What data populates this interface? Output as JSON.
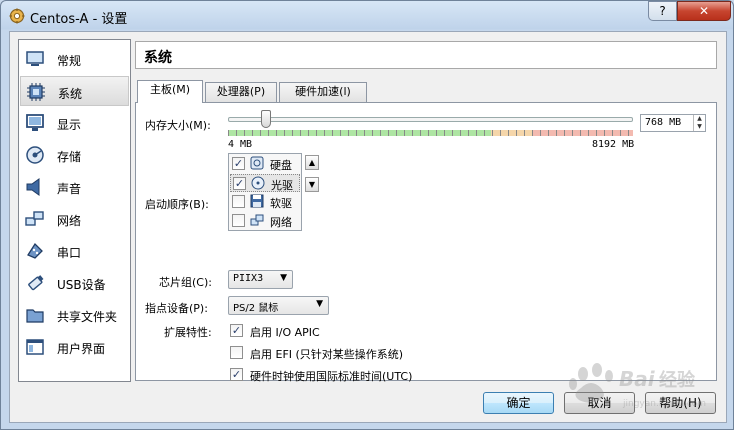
{
  "window": {
    "title": "Centos-A - 设置",
    "help_glyph": "?",
    "close_glyph": "✕"
  },
  "sidebar": {
    "items": [
      {
        "label": "常规",
        "icon": "general-icon"
      },
      {
        "label": "系统",
        "icon": "system-icon",
        "selected": true
      },
      {
        "label": "显示",
        "icon": "display-icon"
      },
      {
        "label": "存储",
        "icon": "storage-icon"
      },
      {
        "label": "声音",
        "icon": "audio-icon"
      },
      {
        "label": "网络",
        "icon": "network-icon"
      },
      {
        "label": "串口",
        "icon": "serial-port-icon"
      },
      {
        "label": "USB设备",
        "icon": "usb-icon"
      },
      {
        "label": "共享文件夹",
        "icon": "shared-folder-icon"
      },
      {
        "label": "用户界面",
        "icon": "user-interface-icon"
      }
    ]
  },
  "header": {
    "title": "系统"
  },
  "tabs": [
    {
      "label": "主板(M)",
      "active": true
    },
    {
      "label": "处理器(P)",
      "active": false
    },
    {
      "label": "硬件加速(l)",
      "active": false
    }
  ],
  "motherboard": {
    "memory": {
      "label": "内存大小(M):",
      "min_label": "4 MB",
      "max_label": "8192 MB",
      "min_mb": 4,
      "max_mb": 8192,
      "value_mb": 768,
      "value_text": "768 MB",
      "zones": {
        "green_fraction": 0.65,
        "orange_fraction": 0.1,
        "red_fraction": 0.25
      }
    },
    "boot_order": {
      "label": "启动顺序(B):",
      "items": [
        {
          "label": "硬盘",
          "checked": true,
          "icon": "hard-disk-icon"
        },
        {
          "label": "光驱",
          "checked": true,
          "icon": "optical-drive-icon",
          "selected": true
        },
        {
          "label": "软驱",
          "checked": false,
          "icon": "floppy-icon"
        },
        {
          "label": "网络",
          "checked": false,
          "icon": "network-boot-icon"
        }
      ],
      "move_up_glyph": "▲",
      "move_down_glyph": "▼"
    },
    "chipset": {
      "label": "芯片组(C):",
      "value": "PIIX3"
    },
    "pointing_device": {
      "label": "指点设备(P):",
      "value": "PS/2 鼠标"
    },
    "extended_features": {
      "label": "扩展特性:",
      "options": [
        {
          "label": "启用 I/O APIC",
          "checked": true
        },
        {
          "label": "启用 EFI (只针对某些操作系统)",
          "checked": false
        },
        {
          "label": "硬件时钟使用国际标准时间(UTC)",
          "checked": true
        }
      ]
    }
  },
  "buttons": {
    "ok": "确定",
    "cancel": "取消",
    "help": "帮助(H)"
  },
  "checkmark": "✓",
  "dropdown_glyph": "▼"
}
